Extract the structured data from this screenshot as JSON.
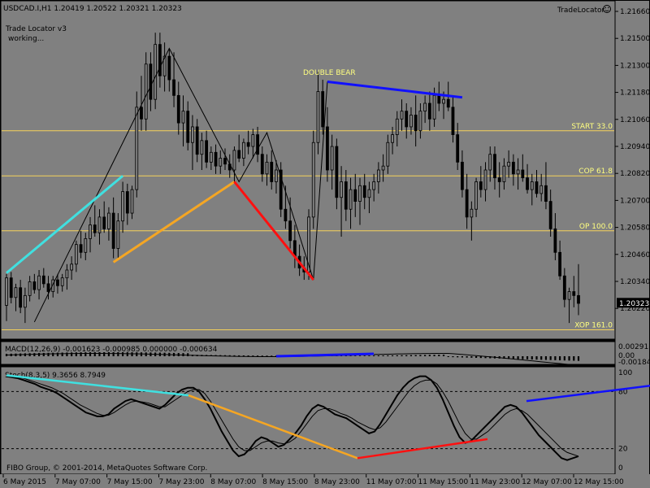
{
  "header": {
    "symbol_line": "USDCAD.I,H1  1.20419 1.20522 1.20321 1.20323",
    "indicator_name": "Trade Locator v3",
    "indicator_status": "working...",
    "brand": "TradeLocator"
  },
  "annotation": {
    "pattern": "DOUBLE BEAR"
  },
  "footer": {
    "copyright": "FIBO Group, © 2001-2014, MetaQuotes Software Corp."
  },
  "colors": {
    "background": "#808080",
    "border": "#000000",
    "candle": "#000000",
    "fib_line": "#f5d25a",
    "label_fib": "#ffff80",
    "leg_cyan": "#40e0e0",
    "leg_orange": "#f5a623",
    "leg_red": "#ff1010",
    "leg_blue": "#1010ff",
    "price_box_bg": "#000000",
    "price_box_text": "#ffffff"
  },
  "chart_data": [
    {
      "type": "candlestick",
      "panel": "price",
      "ylim": [
        1.2015,
        1.2185
      ],
      "price_ticks": [
        "1.21660",
        "1.21500",
        "1.21300",
        "1.21180",
        "1.21060",
        "1.20940",
        "1.20820",
        "1.20700",
        "1.20580",
        "1.20460",
        "1.20340",
        "1.20220"
      ],
      "current_price": "1.20323",
      "fib_levels": [
        {
          "label": "START 33.0",
          "price": 1.212
        },
        {
          "label": "COP 61.8",
          "price": 1.2097
        },
        {
          "label": "OP 100.0",
          "price": 1.2069
        },
        {
          "label": "XOP 161.0",
          "price": 1.20185
        }
      ],
      "pattern_legs": [
        {
          "color": "leg_cyan",
          "from": [
            0,
            1.20475
          ],
          "to": [
            25,
            1.2097
          ]
        },
        {
          "color": "leg_orange",
          "from": [
            23,
            1.2053
          ],
          "to": [
            49,
            1.2094
          ]
        },
        {
          "color": "leg_red",
          "from": [
            49,
            1.2094
          ],
          "to": [
            66,
            1.2044
          ]
        },
        {
          "color": "leg_blue",
          "from": [
            69,
            1.2145
          ],
          "to": [
            98,
            1.2137
          ]
        }
      ],
      "zigzag": [
        [
          6,
          1.20225
        ],
        [
          35,
          1.2162
        ],
        [
          50,
          1.2094
        ],
        [
          56,
          1.2119
        ],
        [
          66,
          1.2044
        ],
        [
          69,
          1.2145
        ]
      ],
      "candles": [
        [
          1.2031,
          1.2047,
          1.2023,
          1.2045
        ],
        [
          1.2045,
          1.2048,
          1.2032,
          1.2035
        ],
        [
          1.2035,
          1.2042,
          1.2028,
          1.204
        ],
        [
          1.204,
          1.2044,
          1.2027,
          1.203
        ],
        [
          1.203,
          1.204,
          1.2022,
          1.2036
        ],
        [
          1.2036,
          1.2046,
          1.2033,
          1.2043
        ],
        [
          1.2043,
          1.2047,
          1.2037,
          1.2039
        ],
        [
          1.2039,
          1.2049,
          1.2034,
          1.2046
        ],
        [
          1.2046,
          1.205,
          1.204,
          1.2042
        ],
        [
          1.2042,
          1.2046,
          1.2034,
          1.2038
        ],
        [
          1.2038,
          1.2046,
          1.2035,
          1.2044
        ],
        [
          1.2044,
          1.2047,
          1.2037,
          1.2041
        ],
        [
          1.2041,
          1.2047,
          1.2038,
          1.2045
        ],
        [
          1.2045,
          1.2052,
          1.2039,
          1.2049
        ],
        [
          1.2049,
          1.2056,
          1.2044,
          1.2052
        ],
        [
          1.2052,
          1.2064,
          1.2048,
          1.2062
        ],
        [
          1.2062,
          1.2069,
          1.2055,
          1.2058
        ],
        [
          1.2058,
          1.2068,
          1.2054,
          1.2065
        ],
        [
          1.2065,
          1.2076,
          1.2058,
          1.2072
        ],
        [
          1.2072,
          1.2082,
          1.2066,
          1.2068
        ],
        [
          1.2068,
          1.208,
          1.2062,
          1.2076
        ],
        [
          1.2076,
          1.2084,
          1.2068,
          1.207
        ],
        [
          1.207,
          1.2081,
          1.2064,
          1.2078
        ],
        [
          1.2078,
          1.2086,
          1.2055,
          1.206
        ],
        [
          1.206,
          1.2078,
          1.2055,
          1.2074
        ],
        [
          1.2074,
          1.2094,
          1.2068,
          1.2089
        ],
        [
          1.2089,
          1.2093,
          1.2072,
          1.2078
        ],
        [
          1.2078,
          1.2092,
          1.2075,
          1.209
        ],
        [
          1.209,
          1.214,
          1.2086,
          1.2132
        ],
        [
          1.2132,
          1.2148,
          1.212,
          1.2126
        ],
        [
          1.2126,
          1.216,
          1.212,
          1.2154
        ],
        [
          1.2154,
          1.216,
          1.213,
          1.2136
        ],
        [
          1.2136,
          1.217,
          1.2131,
          1.2164
        ],
        [
          1.2164,
          1.217,
          1.2142,
          1.2148
        ],
        [
          1.2148,
          1.2165,
          1.214,
          1.2158
        ],
        [
          1.2158,
          1.2162,
          1.214,
          1.2146
        ],
        [
          1.2146,
          1.216,
          1.2132,
          1.2138
        ],
        [
          1.2138,
          1.2145,
          1.2118,
          1.2124
        ],
        [
          1.2124,
          1.2138,
          1.2112,
          1.213
        ],
        [
          1.213,
          1.2135,
          1.211,
          1.2114
        ],
        [
          1.2114,
          1.2128,
          1.21,
          1.2122
        ],
        [
          1.2122,
          1.2126,
          1.2104,
          1.2108
        ],
        [
          1.2108,
          1.2119,
          1.21,
          1.2115
        ],
        [
          1.2115,
          1.212,
          1.2101,
          1.2104
        ],
        [
          1.2104,
          1.2112,
          1.21,
          1.2109
        ],
        [
          1.2109,
          1.2113,
          1.2098,
          1.2102
        ],
        [
          1.2102,
          1.211,
          1.2098,
          1.2106
        ],
        [
          1.2106,
          1.2111,
          1.21,
          1.2103
        ],
        [
          1.2103,
          1.2108,
          1.2096,
          1.21
        ],
        [
          1.21,
          1.2112,
          1.2094,
          1.211
        ],
        [
          1.211,
          1.2118,
          1.2104,
          1.2106
        ],
        [
          1.2106,
          1.2116,
          1.2102,
          1.2114
        ],
        [
          1.2114,
          1.212,
          1.2108,
          1.2112
        ],
        [
          1.2112,
          1.2121,
          1.2106,
          1.2118
        ],
        [
          1.2118,
          1.2122,
          1.2104,
          1.2108
        ],
        [
          1.2108,
          1.2112,
          1.2094,
          1.2098
        ],
        [
          1.2098,
          1.2108,
          1.2092,
          1.2104
        ],
        [
          1.2104,
          1.211,
          1.209,
          1.2094
        ],
        [
          1.2094,
          1.2105,
          1.2088,
          1.21
        ],
        [
          1.21,
          1.2104,
          1.2076,
          1.208
        ],
        [
          1.208,
          1.2092,
          1.207,
          1.2074
        ],
        [
          1.2074,
          1.2086,
          1.206,
          1.2064
        ],
        [
          1.2064,
          1.2072,
          1.205,
          1.2056
        ],
        [
          1.2056,
          1.2062,
          1.2046,
          1.205
        ],
        [
          1.205,
          1.2056,
          1.2044,
          1.2048
        ],
        [
          1.2048,
          1.208,
          1.2044,
          1.2076
        ],
        [
          1.2076,
          1.212,
          1.207,
          1.2114
        ],
        [
          1.2114,
          1.215,
          1.2108,
          1.214
        ],
        [
          1.214,
          1.2146,
          1.2118,
          1.2122
        ],
        [
          1.2122,
          1.2132,
          1.2094,
          1.21
        ],
        [
          1.21,
          1.2118,
          1.209,
          1.2112
        ],
        [
          1.2112,
          1.2116,
          1.208,
          1.2086
        ],
        [
          1.2086,
          1.2102,
          1.2066,
          1.2094
        ],
        [
          1.2094,
          1.21,
          1.2074,
          1.208
        ],
        [
          1.208,
          1.2096,
          1.207,
          1.209
        ],
        [
          1.209,
          1.2098,
          1.2076,
          1.2084
        ],
        [
          1.2084,
          1.2096,
          1.2072,
          1.2092
        ],
        [
          1.2092,
          1.2098,
          1.208,
          1.2086
        ],
        [
          1.2086,
          1.2094,
          1.2078,
          1.209
        ],
        [
          1.209,
          1.2098,
          1.2084,
          1.2094
        ],
        [
          1.2094,
          1.2104,
          1.2088,
          1.21
        ],
        [
          1.21,
          1.2108,
          1.2094,
          1.2102
        ],
        [
          1.2102,
          1.2118,
          1.2098,
          1.2114
        ],
        [
          1.2114,
          1.2122,
          1.2108,
          1.2118
        ],
        [
          1.2118,
          1.213,
          1.2112,
          1.2126
        ],
        [
          1.2126,
          1.2136,
          1.212,
          1.213
        ],
        [
          1.213,
          1.2134,
          1.2116,
          1.2122
        ],
        [
          1.2122,
          1.2132,
          1.2118,
          1.2128
        ],
        [
          1.2128,
          1.2138,
          1.2112,
          1.212
        ],
        [
          1.212,
          1.2134,
          1.2116,
          1.213
        ],
        [
          1.213,
          1.2138,
          1.2124,
          1.2134
        ],
        [
          1.2134,
          1.214,
          1.212,
          1.2126
        ],
        [
          1.2126,
          1.2142,
          1.2122,
          1.2138
        ],
        [
          1.2138,
          1.2145,
          1.213,
          1.2134
        ],
        [
          1.2134,
          1.214,
          1.2126,
          1.2136
        ],
        [
          1.2136,
          1.2145,
          1.213,
          1.2132
        ],
        [
          1.2132,
          1.2138,
          1.2114,
          1.2118
        ],
        [
          1.2118,
          1.2124,
          1.21,
          1.2104
        ],
        [
          1.2104,
          1.211,
          1.2086,
          1.209
        ],
        [
          1.209,
          1.2098,
          1.207,
          1.2076
        ],
        [
          1.2076,
          1.2084,
          1.2064,
          1.208
        ],
        [
          1.208,
          1.2096,
          1.2076,
          1.2094
        ],
        [
          1.2094,
          1.2102,
          1.2086,
          1.209
        ],
        [
          1.209,
          1.2104,
          1.2084,
          1.21
        ],
        [
          1.21,
          1.2112,
          1.2094,
          1.2108
        ],
        [
          1.2108,
          1.2112,
          1.209,
          1.2096
        ],
        [
          1.2096,
          1.2104,
          1.2086,
          1.2094
        ],
        [
          1.2094,
          1.2106,
          1.209,
          1.2102
        ],
        [
          1.2102,
          1.211,
          1.2096,
          1.2104
        ],
        [
          1.2104,
          1.2108,
          1.2092,
          1.2098
        ],
        [
          1.2098,
          1.2106,
          1.209,
          1.21
        ],
        [
          1.21,
          1.2108,
          1.2094,
          1.2096
        ],
        [
          1.2096,
          1.2103,
          1.2088,
          1.209
        ],
        [
          1.209,
          1.2098,
          1.2082,
          1.2094
        ],
        [
          1.2094,
          1.21,
          1.2086,
          1.2088
        ],
        [
          1.2088,
          1.2098,
          1.2084,
          1.2092
        ],
        [
          1.2092,
          1.2104,
          1.208,
          1.2084
        ],
        [
          1.2084,
          1.209,
          1.2066,
          1.207
        ],
        [
          1.207,
          1.2078,
          1.2054,
          1.2058
        ],
        [
          1.2058,
          1.2064,
          1.2044,
          1.2046
        ],
        [
          1.2046,
          1.205,
          1.203,
          1.2034
        ],
        [
          1.2034,
          1.204,
          1.2022,
          1.2038
        ],
        [
          1.2038,
          1.2046,
          1.203,
          1.2036
        ],
        [
          1.2036,
          1.2052,
          1.2026,
          1.2032
        ]
      ]
    },
    {
      "type": "line",
      "panel": "macd",
      "title": "MACD(12,26,9) -0.001623 -0.000985 0.000000 -0.000634",
      "ticks": [
        "0.002915",
        "0.00",
        "-0.00184"
      ],
      "ylim": [
        -0.003,
        0.0035
      ]
    },
    {
      "type": "line",
      "panel": "stoch",
      "title": "Stoch(8,3,5) 9.3656 8.7949",
      "ticks": [
        "100",
        "80",
        "20",
        "0"
      ],
      "ylim": [
        0,
        100
      ],
      "levels": [
        20,
        80
      ],
      "main": [
        96,
        95,
        94,
        92,
        90,
        88,
        85,
        83,
        81,
        78,
        74,
        70,
        66,
        62,
        58,
        56,
        54,
        54,
        56,
        62,
        66,
        70,
        72,
        70,
        68,
        66,
        64,
        62,
        66,
        72,
        78,
        82,
        84,
        84,
        80,
        72,
        62,
        50,
        38,
        28,
        18,
        12,
        14,
        20,
        28,
        32,
        30,
        26,
        22,
        24,
        30,
        36,
        44,
        54,
        62,
        66,
        64,
        60,
        56,
        54,
        52,
        48,
        44,
        40,
        36,
        38,
        46,
        56,
        66,
        76,
        84,
        90,
        94,
        96,
        96,
        92,
        84,
        72,
        58,
        44,
        32,
        26,
        28,
        34,
        40,
        46,
        52,
        58,
        64,
        66,
        64,
        58,
        50,
        42,
        34,
        28,
        22,
        16,
        10,
        8,
        10,
        12
      ],
      "signal": [
        97,
        96,
        95,
        94,
        92,
        90,
        88,
        86,
        84,
        81,
        78,
        74,
        70,
        66,
        63,
        60,
        57,
        55,
        55,
        58,
        62,
        66,
        69,
        70,
        69,
        68,
        66,
        64,
        64,
        68,
        72,
        76,
        80,
        82,
        82,
        78,
        70,
        60,
        50,
        40,
        30,
        22,
        18,
        18,
        22,
        26,
        28,
        28,
        26,
        25,
        27,
        31,
        38,
        46,
        54,
        60,
        62,
        62,
        60,
        57,
        55,
        52,
        48,
        45,
        42,
        40,
        42,
        48,
        56,
        64,
        72,
        80,
        86,
        90,
        92,
        92,
        88,
        80,
        70,
        58,
        46,
        36,
        30,
        30,
        34,
        38,
        44,
        50,
        56,
        60,
        62,
        60,
        56,
        50,
        44,
        38,
        32,
        26,
        20,
        16,
        14,
        12
      ],
      "legs": [
        {
          "color": "leg_cyan",
          "from": [
            0,
            97
          ],
          "to": [
            14,
            76
          ]
        },
        {
          "color": "leg_orange",
          "from": [
            14,
            76
          ],
          "to": [
            27,
            10
          ]
        },
        {
          "color": "leg_red",
          "from": [
            27,
            10
          ],
          "to": [
            37,
            30
          ]
        },
        {
          "color": "leg_blue",
          "from": [
            40,
            70
          ],
          "to": [
            53,
            92
          ]
        }
      ]
    }
  ],
  "xaxis_labels": [
    "6 May 2015",
    "7 May 07:00",
    "7 May 15:00",
    "7 May 23:00",
    "8 May 07:00",
    "8 May 15:00",
    "8 May 23:00",
    "11 May 07:00",
    "11 May 15:00",
    "11 May 23:00",
    "12 May 07:00",
    "12 May 15:00"
  ]
}
